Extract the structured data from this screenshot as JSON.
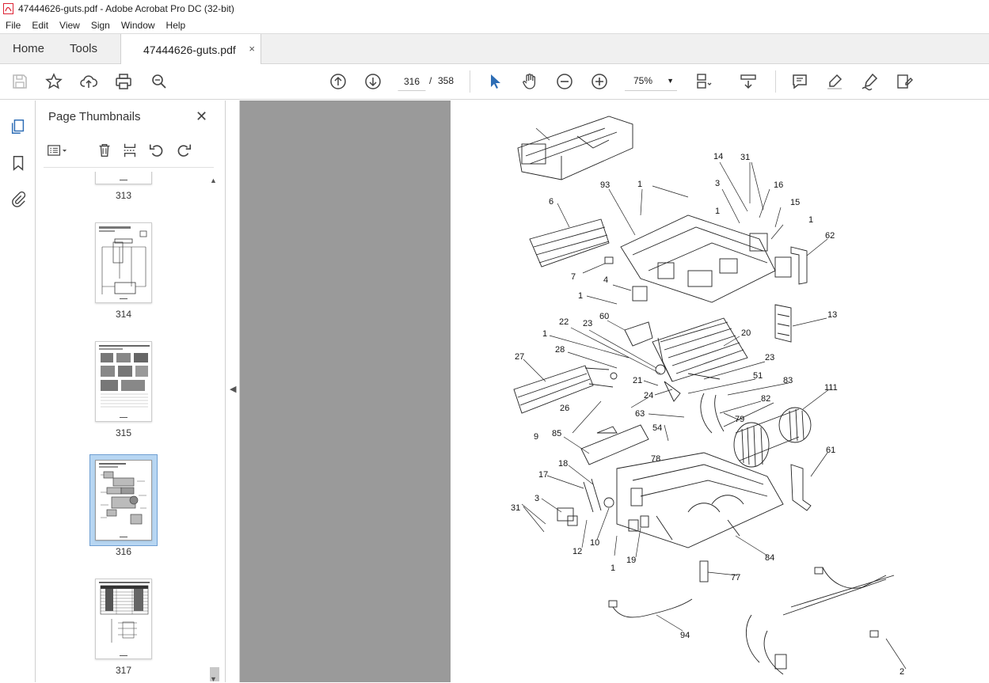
{
  "window": {
    "title": "47444626-guts.pdf - Adobe Acrobat Pro DC (32-bit)"
  },
  "menu": [
    "File",
    "Edit",
    "View",
    "Sign",
    "Window",
    "Help"
  ],
  "tabs": {
    "home": "Home",
    "tools": "Tools",
    "document": "47444626-guts.pdf",
    "close": "×"
  },
  "toolbar": {
    "current_page": "316",
    "separator": "/",
    "total_pages": "358",
    "zoom": "75%"
  },
  "panel": {
    "title": "Page Thumbnails",
    "close": "✕",
    "thumbnails": [
      {
        "label": "313"
      },
      {
        "label": "314"
      },
      {
        "label": "315"
      },
      {
        "label": "316",
        "selected": true
      },
      {
        "label": "317"
      }
    ]
  },
  "diagram": {
    "callouts": [
      "14",
      "31",
      "93",
      "1",
      "3",
      "16",
      "6",
      "15",
      "1",
      "62",
      "1",
      "7",
      "4",
      "1",
      "13",
      "60",
      "20",
      "22",
      "23",
      "1",
      "28",
      "23",
      "27",
      "51",
      "21",
      "83",
      "24",
      "82",
      "111",
      "26",
      "79",
      "63",
      "85",
      "54",
      "9",
      "78",
      "61",
      "18",
      "17",
      "31",
      "3",
      "10",
      "12",
      "1",
      "19",
      "84",
      "77",
      "94",
      "2"
    ]
  },
  "colors": {
    "accent": "#2d6db5",
    "viewer_bg": "#9a9a9a",
    "selected_thumb": "#b7d6f2"
  }
}
